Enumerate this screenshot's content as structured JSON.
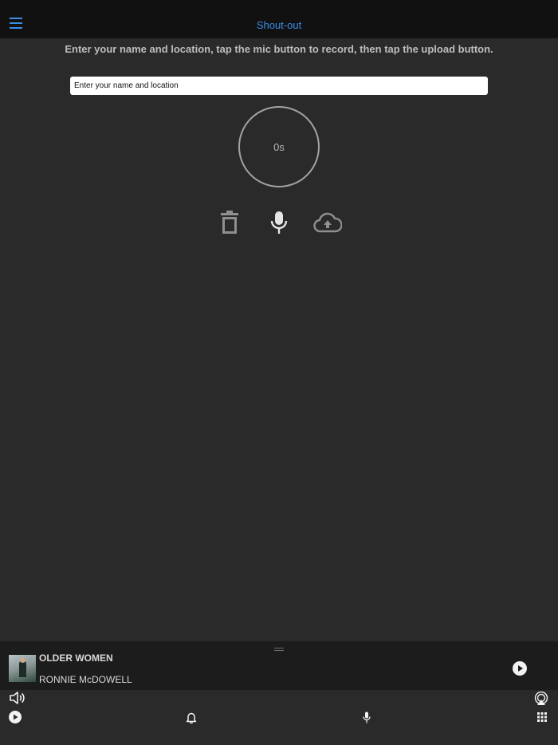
{
  "header": {
    "title": "Shout-out",
    "menu_icon": "hamburger-icon",
    "accent_color": "#3a8ee6"
  },
  "main": {
    "instructions": "Enter your name and location, tap the mic button to record, then tap the upload button.",
    "name_input": {
      "placeholder": "Enter your name and location",
      "value": ""
    },
    "timer": "0s",
    "actions": [
      "trash-icon",
      "microphone-icon",
      "cloud-upload-icon"
    ]
  },
  "player": {
    "song_title": "OLDER WOMEN",
    "artist": "RONNIE McDOWELL",
    "play_icon": "play-circle-icon"
  },
  "bottom_bar": {
    "volume_icon": "volume-icon",
    "airplay_icon": "airplay-icon",
    "tabs": [
      "play-tab-icon",
      "bell-icon",
      "microphone-tab-icon",
      "grid-icon"
    ]
  }
}
